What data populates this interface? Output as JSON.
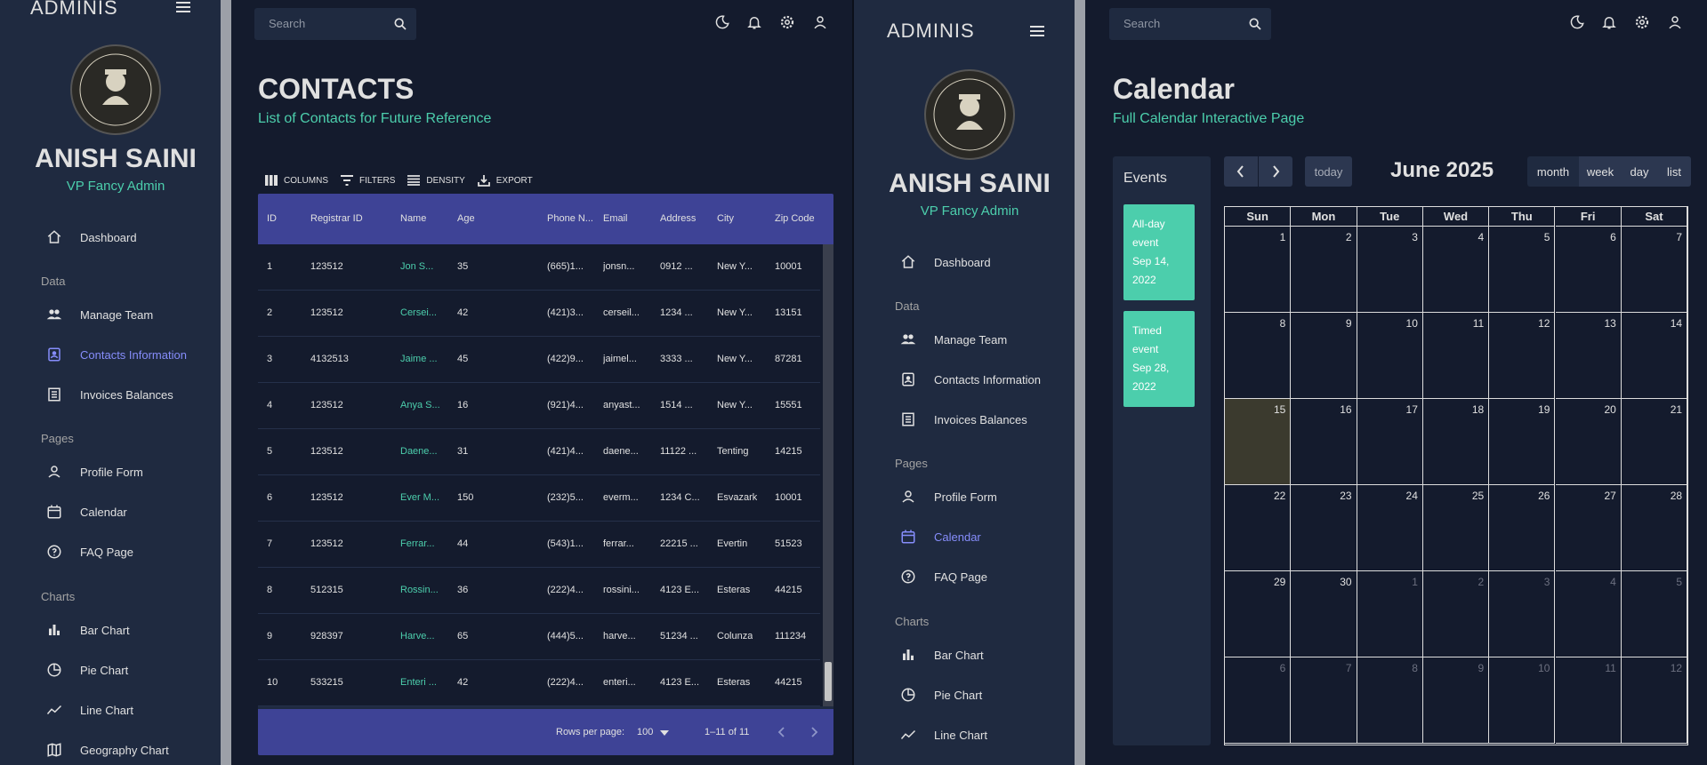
{
  "left": {
    "brand": "ADMINIS",
    "user_name": "ANISH SAINI",
    "user_role": "VP Fancy Admin",
    "nav": {
      "dashboard": "Dashboard",
      "sec_data": "Data",
      "manage_team": "Manage Team",
      "contacts": "Contacts Information",
      "invoices": "Invoices Balances",
      "sec_pages": "Pages",
      "profile": "Profile Form",
      "calendar": "Calendar",
      "faq": "FAQ Page",
      "sec_charts": "Charts",
      "bar": "Bar Chart",
      "pie": "Pie Chart",
      "line": "Line Chart",
      "geo": "Geography Chart"
    },
    "search_placeholder": "Search",
    "title": "CONTACTS",
    "subtitle": "List of Contacts for Future Reference",
    "toolbar": {
      "columns": "COLUMNS",
      "filters": "FILTERS",
      "density": "DENSITY",
      "export": "EXPORT"
    },
    "headers": [
      "ID",
      "Registrar ID",
      "Name",
      "Age",
      "Phone N...",
      "Email",
      "Address",
      "City",
      "Zip Code"
    ],
    "rows": [
      [
        "1",
        "123512",
        "Jon S...",
        "35",
        "(665)1...",
        "jonsn...",
        "0912 ...",
        "New Y...",
        "10001"
      ],
      [
        "2",
        "123512",
        "Cersei...",
        "42",
        "(421)3...",
        "cerseil...",
        "1234 ...",
        "New Y...",
        "13151"
      ],
      [
        "3",
        "4132513",
        "Jaime ...",
        "45",
        "(422)9...",
        "jaimel...",
        "3333 ...",
        "New Y...",
        "87281"
      ],
      [
        "4",
        "123512",
        "Anya S...",
        "16",
        "(921)4...",
        "anyast...",
        "1514 ...",
        "New Y...",
        "15551"
      ],
      [
        "5",
        "123512",
        "Daene...",
        "31",
        "(421)4...",
        "daene...",
        "11122 ...",
        "Tenting",
        "14215"
      ],
      [
        "6",
        "123512",
        "Ever M...",
        "150",
        "(232)5...",
        "everm...",
        "1234 C...",
        "Esvazark",
        "10001"
      ],
      [
        "7",
        "123512",
        "Ferrar...",
        "44",
        "(543)1...",
        "ferrar...",
        "22215 ...",
        "Evertin",
        "51523"
      ],
      [
        "8",
        "512315",
        "Rossin...",
        "36",
        "(222)4...",
        "rossini...",
        "4123 E...",
        "Esteras",
        "44215"
      ],
      [
        "9",
        "928397",
        "Harve...",
        "65",
        "(444)5...",
        "harve...",
        "51234 ...",
        "Colunza",
        "111234"
      ],
      [
        "10",
        "533215",
        "Enteri ...",
        "42",
        "(222)4...",
        "enteri...",
        "4123 E...",
        "Esteras",
        "44215"
      ]
    ],
    "footer": {
      "rows_per_page": "Rows per page:",
      "rows_value": "100",
      "range": "1–11 of 11"
    }
  },
  "right": {
    "brand": "ADMINIS",
    "user_name": "ANISH SAINI",
    "user_role": "VP Fancy Admin",
    "nav": {
      "dashboard": "Dashboard",
      "sec_data": "Data",
      "manage_team": "Manage Team",
      "contacts": "Contacts Information",
      "invoices": "Invoices Balances",
      "sec_pages": "Pages",
      "profile": "Profile Form",
      "calendar": "Calendar",
      "faq": "FAQ Page",
      "sec_charts": "Charts",
      "bar": "Bar Chart",
      "pie": "Pie Chart",
      "line": "Line Chart"
    },
    "search_placeholder": "Search",
    "title": "Calendar",
    "subtitle": "Full Calendar Interactive Page",
    "events_title": "Events",
    "events": [
      {
        "lines": [
          "All-day",
          "event",
          "Sep 14,",
          "2022"
        ]
      },
      {
        "lines": [
          "Timed",
          "event",
          "Sep 28,",
          "2022"
        ]
      }
    ],
    "today_label": "today",
    "month_title": "June 2025",
    "views": [
      "month",
      "week",
      "day",
      "list"
    ],
    "weekdays": [
      "Sun",
      "Mon",
      "Tue",
      "Wed",
      "Thu",
      "Fri",
      "Sat"
    ],
    "days": [
      "1",
      "2",
      "3",
      "4",
      "5",
      "6",
      "7",
      "8",
      "9",
      "10",
      "11",
      "12",
      "13",
      "14",
      "15",
      "16",
      "17",
      "18",
      "19",
      "20",
      "21",
      "22",
      "23",
      "24",
      "25",
      "26",
      "27",
      "28",
      "29",
      "30",
      "1",
      "2",
      "3",
      "4",
      "5",
      "6",
      "7",
      "8",
      "9",
      "10",
      "11",
      "12"
    ],
    "today_index": 14,
    "first_muted_index": 30
  },
  "colors": {
    "bg": "#141b2d",
    "panel": "#1f2a40",
    "accent": "#4cceac",
    "header": "#3e4396",
    "active": "#868dfb"
  }
}
